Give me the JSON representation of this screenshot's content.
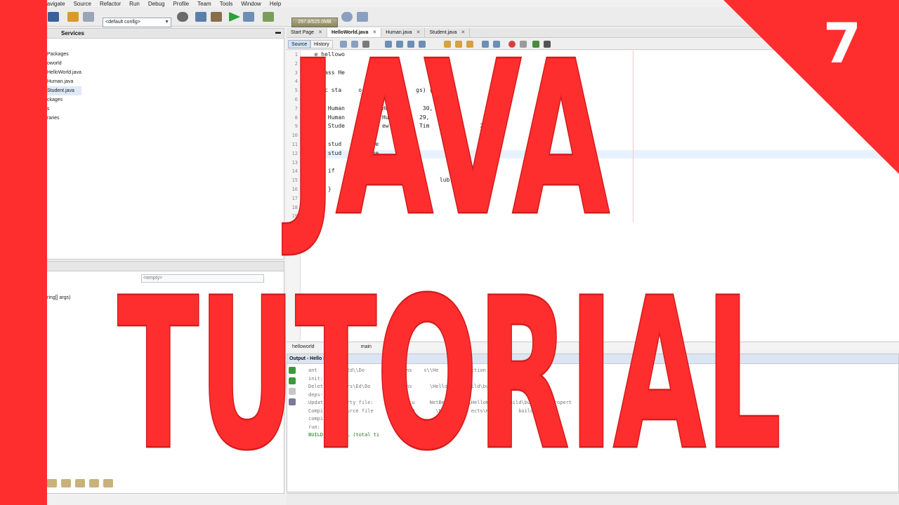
{
  "ide": {
    "menu": [
      "Navigate",
      "Source",
      "Refactor",
      "Run",
      "Debug",
      "Profile",
      "Team",
      "Tools",
      "Window",
      "Help"
    ],
    "toolbar": {
      "config": "<default config>",
      "memory": "297.8/525.0MB"
    },
    "left_panel": {
      "tab_services": "Services",
      "tree": [
        "Packages",
        "oworld",
        "HelloWorld.java",
        "Human.java",
        "Student.java",
        "ckages",
        "s",
        "raries"
      ]
    },
    "navigator": {
      "combo": "<empty>",
      "member": "ring[] args)"
    },
    "editor_tabs": [
      "Start Page",
      "HelloWorld.java",
      "Human.java",
      "Student.java"
    ],
    "editor_toolbar": {
      "source": "Source",
      "history": "History"
    },
    "line_numbers": [
      "1",
      "2",
      "3",
      "4",
      "5",
      "6",
      "7",
      "8",
      "9",
      "10",
      "11",
      "12",
      "13",
      "14",
      "15",
      "16",
      "17",
      "18",
      "19"
    ],
    "code_lines": [
      "  e hellowo",
      "",
      "   class He",
      "",
      "  blic sta     o    n(Strin     gs) {",
      "",
      "      Human    1      Human(      30,    ;",
      "      Human    2      Human(\"    29,",
      "      Stude   udent   ew Stu     Tim     1.75,     23\");",
      "",
      "      stud      setHe     0000);",
      "      stud     setAge     );",
      "",
      "      if                   {",
      "            m.out.p       (\"Welc       lub!\");",
      "      }",
      "",
      "",
      ""
    ],
    "breadcrumb": {
      "package": "helloworld",
      "method": "main"
    },
    "output": {
      "title": "Output - Hello         n)",
      "lines": [
        "ant    ersa\\\\Ed\\\\Do      \\\\NetBeans    s\\\\He          action        run",
        "init:",
        "Delet     Users\\Ed\\Do      NetBeans      \\Hello      build\\buil    propert",
        "deps-",
        "Updat      perty file:      \\Ed\\Docu     NetBeans     \\HelloW      build\\bu       propert",
        "Compi       ource file      ers\\Ed\\D       \\NetBe      ects\\Hel        build\\",
        "compi",
        "run:",
        "BUILD      FUL (total ti"
      ]
    }
  },
  "overlay": {
    "title_line1": "JAVA",
    "title_line2": "TUTORIAL",
    "episode": "7",
    "colors": {
      "red": "#ff2e2e",
      "white": "#ffffff",
      "outline": "#d41c1c"
    }
  }
}
